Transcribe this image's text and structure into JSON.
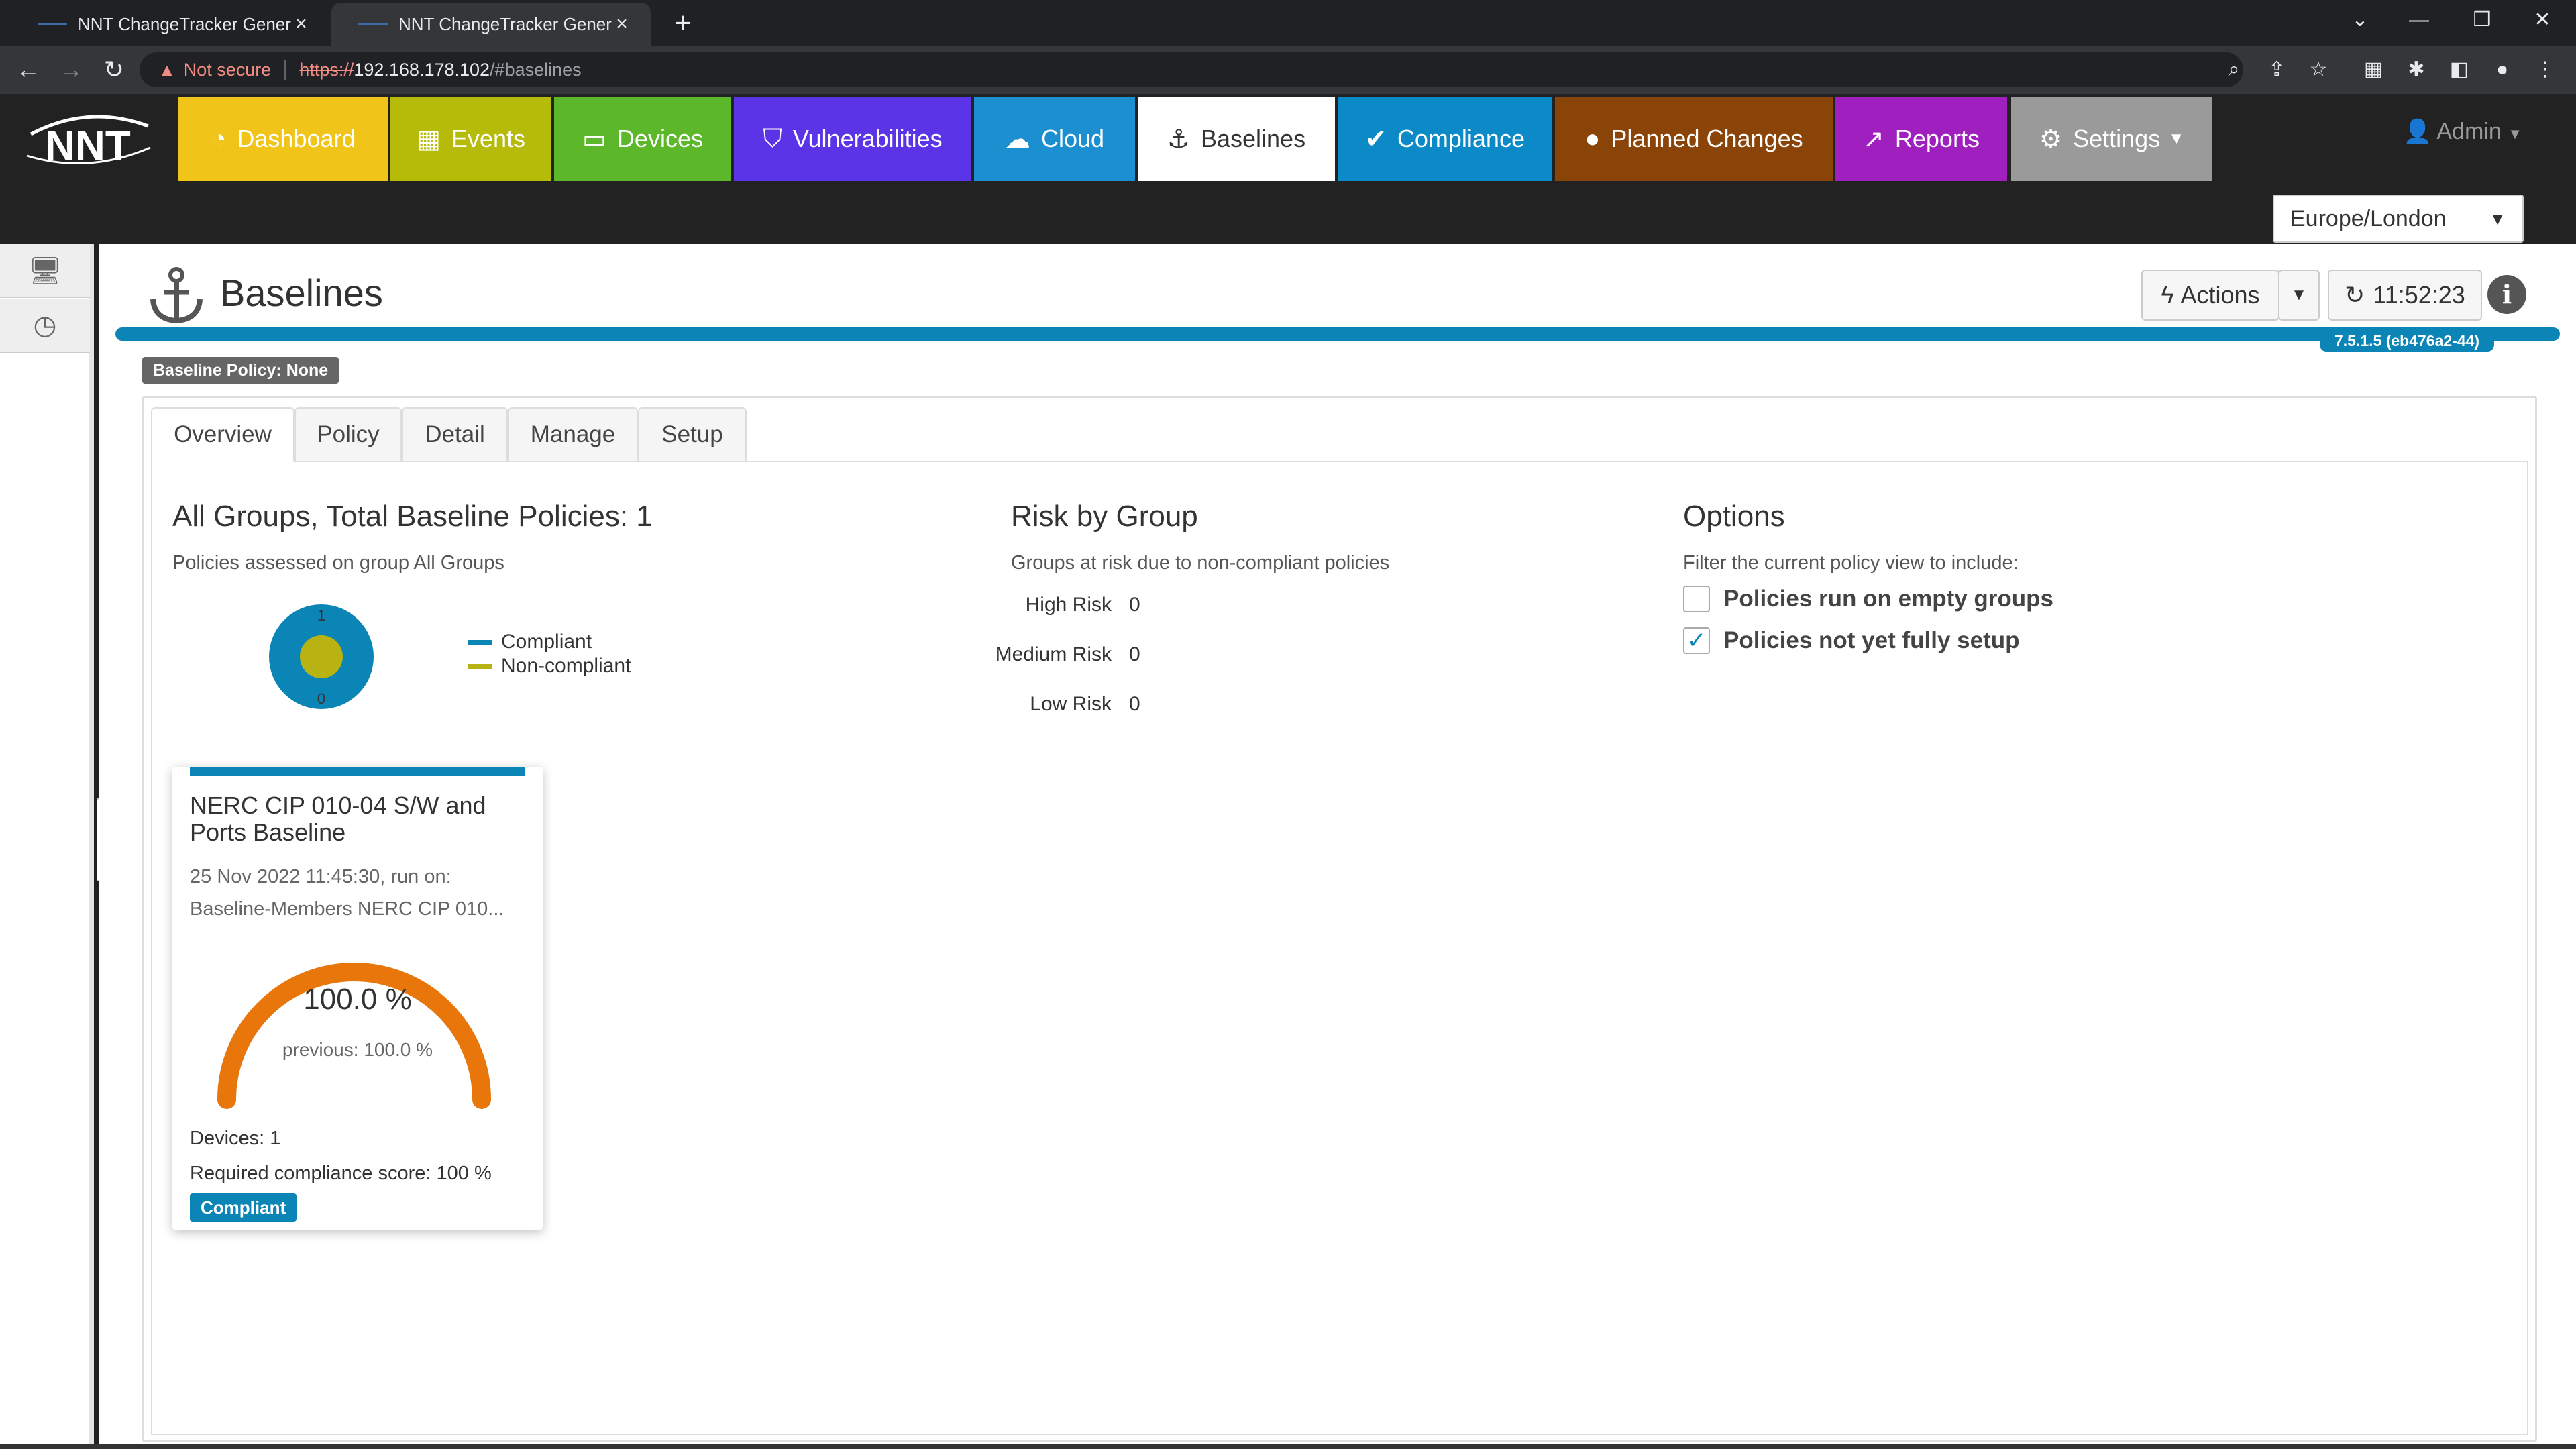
{
  "browser": {
    "tabs": [
      {
        "title": "NNT ChangeTracker Generation"
      },
      {
        "title": "NNT ChangeTracker Generation"
      }
    ],
    "security_warning": "Not secure",
    "url_scheme": "https://",
    "url_host": "192.168.178.102",
    "url_path": "/#baselines"
  },
  "app": {
    "logo_text": "NNT",
    "nav": [
      {
        "label": "Dashboard",
        "icon": "dashboard-icon",
        "color": "#f0c419"
      },
      {
        "label": "Events",
        "icon": "calendar-icon",
        "color": "#b6ba09"
      },
      {
        "label": "Devices",
        "icon": "monitor-icon",
        "color": "#5cb82a"
      },
      {
        "label": "Vulnerabilities",
        "icon": "shield-icon",
        "color": "#5a34e6"
      },
      {
        "label": "Cloud",
        "icon": "cloud-icon",
        "color": "#1b8fd0"
      },
      {
        "label": "Baselines",
        "icon": "anchor-icon",
        "color": "#ffffff"
      },
      {
        "label": "Compliance",
        "icon": "checkmark-icon",
        "color": "#0b8ac7"
      },
      {
        "label": "Planned Changes",
        "icon": "chat-bubble-icon",
        "color": "#8a4407"
      },
      {
        "label": "Reports",
        "icon": "chart-icon",
        "color": "#a01fbf"
      },
      {
        "label": "Settings",
        "icon": "gear-icon",
        "color": "#9a9a9a"
      }
    ],
    "user": "Admin",
    "timezone": "Europe/London"
  },
  "page": {
    "title": "Baselines",
    "actions_label": "Actions",
    "refresh_time": "11:52:23",
    "version": "7.5.1.5 (eb476a2-44)",
    "policy_badge": "Baseline Policy: None",
    "tabs": [
      "Overview",
      "Policy",
      "Detail",
      "Manage",
      "Setup"
    ],
    "active_tab": "Overview"
  },
  "overview": {
    "groups_heading": "All Groups, Total Baseline Policies: 1",
    "groups_sub": "Policies assessed on group All Groups",
    "donut": {
      "compliant": 1,
      "noncompliant": 0,
      "compliant_color": "#0a85b5",
      "noncompliant_color": "#b8b312"
    },
    "legend": [
      {
        "label": "Compliant",
        "color": "#0a85b5"
      },
      {
        "label": "Non-compliant",
        "color": "#b8b312"
      }
    ],
    "risk_heading": "Risk by Group",
    "risk_sub": "Groups at risk due to non-compliant policies",
    "risk": [
      {
        "label": "High Risk",
        "value": "0"
      },
      {
        "label": "Medium Risk",
        "value": "0"
      },
      {
        "label": "Low Risk",
        "value": "0"
      }
    ],
    "options_heading": "Options",
    "options_sub": "Filter the current policy view to include:",
    "options": [
      {
        "label": "Policies run on empty groups",
        "checked": false
      },
      {
        "label": "Policies not yet fully setup",
        "checked": true
      }
    ]
  },
  "card": {
    "title": "NERC CIP 010-04 S/W and Ports Baseline",
    "date": "25 Nov 2022 11:45:30, run on:",
    "members": "Baseline-Members NERC CIP 010...",
    "percent": "100.0 %",
    "percent_value": 100,
    "previous": "previous: 100.0 %",
    "devices": "Devices: 1",
    "required": "Required compliance score: 100 %",
    "status": "Compliant",
    "gauge_color": "#e8760a"
  }
}
